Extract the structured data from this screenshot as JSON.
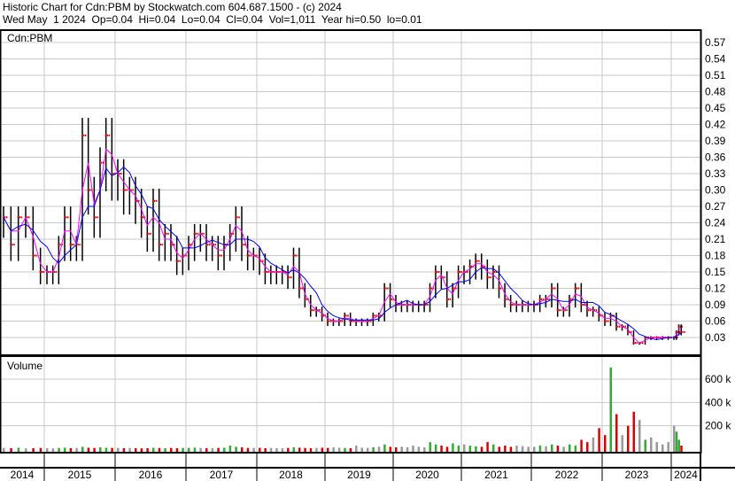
{
  "header": {
    "title": "Historic Chart for Cdn:PBM by Stockwatch.com 604.687.1500 - (c) 2024",
    "quote": "Wed May  1 2024  Op=0.04  Hi=0.04  Lo=0.04  Cl=0.04  Vol=1,011  Year hi=0.50  lo=0.01"
  },
  "chart_data": {
    "type": "line",
    "symbol": "Cdn:PBM",
    "volume_label": "Volume",
    "start": "2014-07",
    "price_ticks": [
      "0.03",
      "0.06",
      "0.09",
      "0.12",
      "0.15",
      "0.18",
      "0.21",
      "0.24",
      "0.27",
      "0.30",
      "0.33",
      "0.36",
      "0.39",
      "0.42",
      "0.45",
      "0.48",
      "0.51",
      "0.54",
      "0.57"
    ],
    "price_ylim": [
      0,
      0.585
    ],
    "volume_ticks": [
      "200 k",
      "400 k",
      "600 k"
    ],
    "volume_ylim": [
      0,
      800
    ],
    "years": [
      "2014",
      "2015",
      "2016",
      "2017",
      "2018",
      "2019",
      "2020",
      "2021",
      "2022",
      "2023",
      "2024"
    ],
    "monthly_close": [
      0.25,
      0.2,
      0.25,
      0.25,
      0.18,
      0.15,
      0.15,
      0.15,
      0.2,
      0.25,
      0.2,
      0.2,
      0.4,
      0.3,
      0.25,
      0.35,
      0.4,
      0.33,
      0.33,
      0.3,
      0.3,
      0.28,
      0.25,
      0.22,
      0.28,
      0.2,
      0.22,
      0.2,
      0.17,
      0.18,
      0.2,
      0.22,
      0.22,
      0.2,
      0.2,
      0.18,
      0.2,
      0.22,
      0.25,
      0.2,
      0.18,
      0.18,
      0.17,
      0.15,
      0.15,
      0.15,
      0.15,
      0.14,
      0.18,
      0.12,
      0.1,
      0.08,
      0.08,
      0.07,
      0.06,
      0.06,
      0.06,
      0.07,
      0.06,
      0.06,
      0.06,
      0.06,
      0.07,
      0.07,
      0.12,
      0.1,
      0.09,
      0.09,
      0.09,
      0.09,
      0.09,
      0.09,
      0.12,
      0.15,
      0.14,
      0.1,
      0.12,
      0.15,
      0.15,
      0.16,
      0.17,
      0.16,
      0.14,
      0.15,
      0.12,
      0.1,
      0.09,
      0.09,
      0.09,
      0.09,
      0.09,
      0.1,
      0.1,
      0.12,
      0.08,
      0.08,
      0.1,
      0.12,
      0.09,
      0.08,
      0.08,
      0.07,
      0.06,
      0.07,
      0.05,
      0.05,
      0.04,
      0.02,
      0.02,
      0.03,
      0.03,
      0.03,
      0.03,
      0.03,
      0.03,
      0.04,
      0.05,
      0.04
    ],
    "monthly_volume_k": [
      10,
      8,
      12,
      6,
      8,
      10,
      8,
      6,
      10,
      12,
      8,
      10,
      20,
      12,
      10,
      15,
      12,
      10,
      10,
      8,
      10,
      8,
      6,
      8,
      12,
      10,
      8,
      10,
      8,
      10,
      10,
      12,
      10,
      8,
      8,
      10,
      12,
      30,
      20,
      15,
      10,
      10,
      10,
      8,
      10,
      8,
      8,
      10,
      15,
      12,
      10,
      8,
      10,
      12,
      10,
      15,
      12,
      10,
      8,
      30,
      12,
      10,
      15,
      20,
      40,
      20,
      15,
      20,
      15,
      30,
      20,
      15,
      60,
      40,
      30,
      20,
      50,
      30,
      40,
      30,
      25,
      20,
      60,
      40,
      20,
      30,
      20,
      30,
      25,
      20,
      20,
      30,
      25,
      40,
      30,
      20,
      40,
      30,
      80,
      60,
      100,
      180,
      120,
      700,
      300,
      120,
      200,
      320,
      250,
      80,
      100,
      60,
      40,
      60,
      200,
      150,
      80,
      30
    ]
  },
  "colors": {
    "grid": "#c8c8c8",
    "ma_short": "#ff00ff",
    "ma_long": "#0000ff",
    "bar": "#000000",
    "dot": "#e00000",
    "vol_up": "#33aa33",
    "vol_down": "#dd0000",
    "vol_flat": "#999999"
  }
}
